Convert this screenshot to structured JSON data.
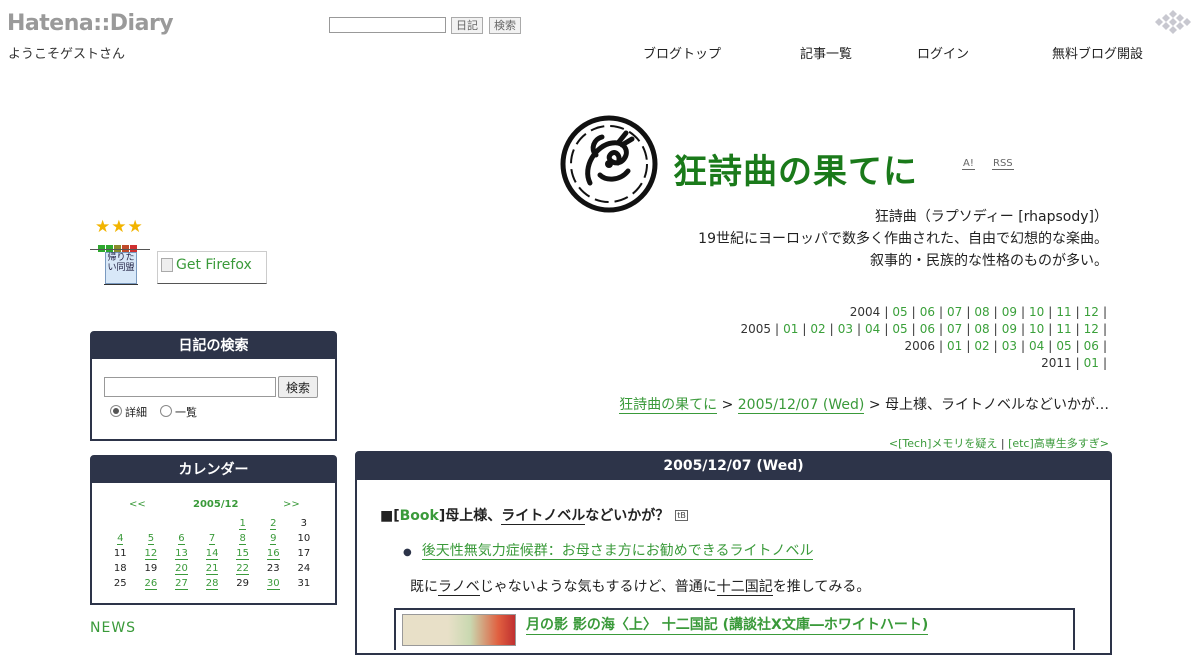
{
  "hatena": {
    "logo": "Hatena::Diary",
    "welcome": "ようこそゲストさん",
    "search_placeholder": "",
    "diary_button": "日記",
    "search_button": "検索",
    "nav": {
      "blog_top": "ブログトップ",
      "article_list": "記事一覧",
      "login": "ログイン",
      "create_blog": "無料ブログ開設"
    }
  },
  "blog": {
    "title": "狂詩曲の果てに",
    "ai_link": "A!",
    "rss_link": "RSS",
    "description": [
      "狂詩曲（ラプソディー [rhapsody]）",
      "19世紀にヨーロッパで数多く作曲された、自由で幻想的な楽曲。",
      "叙事的・民族的な性格のものが多い。"
    ]
  },
  "archive": [
    {
      "year": "2004",
      "months": [
        "05",
        "06",
        "07",
        "08",
        "09",
        "10",
        "11",
        "12"
      ]
    },
    {
      "year": "2005",
      "months": [
        "01",
        "02",
        "03",
        "04",
        "05",
        "06",
        "07",
        "08",
        "09",
        "10",
        "11",
        "12"
      ]
    },
    {
      "year": "2006",
      "months": [
        "01",
        "02",
        "03",
        "04",
        "05",
        "06"
      ]
    },
    {
      "year": "2011",
      "months": [
        "01"
      ]
    }
  ],
  "breadcrumb": {
    "home": "狂詩曲の果てに",
    "date": "2005/12/07 (Wed)",
    "current": "母上様、ライトノベルなどいかが…"
  },
  "prevnext": {
    "prev": "<[Tech]メモリを疑え",
    "next": "[etc]高専生多すぎ>"
  },
  "sidebar": {
    "stars": "★★★",
    "color_stars": [
      "#2ea82e",
      "#2ea82e",
      "#8a8a2a",
      "#c04a2a",
      "#d03030"
    ],
    "badge_text": "帰りたい同盟",
    "firefox_alt": "Get Firefox",
    "search": {
      "title": "日記の検索",
      "button": "検索",
      "radio_detail": "詳細",
      "radio_list": "一覧"
    },
    "calendar": {
      "title": "カレンダー",
      "prev": "<<",
      "month": "2005/12",
      "next": ">>",
      "weeks": [
        [
          {
            "d": "",
            "l": false
          },
          {
            "d": "",
            "l": false
          },
          {
            "d": "",
            "l": false
          },
          {
            "d": "",
            "l": false
          },
          {
            "d": "1",
            "l": true
          },
          {
            "d": "2",
            "l": true
          },
          {
            "d": "3",
            "l": false
          }
        ],
        [
          {
            "d": "4",
            "l": true
          },
          {
            "d": "5",
            "l": true
          },
          {
            "d": "6",
            "l": true
          },
          {
            "d": "7",
            "l": true
          },
          {
            "d": "8",
            "l": true
          },
          {
            "d": "9",
            "l": true
          },
          {
            "d": "10",
            "l": false
          }
        ],
        [
          {
            "d": "11",
            "l": false
          },
          {
            "d": "12",
            "l": true
          },
          {
            "d": "13",
            "l": true
          },
          {
            "d": "14",
            "l": true
          },
          {
            "d": "15",
            "l": true
          },
          {
            "d": "16",
            "l": true
          },
          {
            "d": "17",
            "l": false
          }
        ],
        [
          {
            "d": "18",
            "l": false
          },
          {
            "d": "19",
            "l": false
          },
          {
            "d": "20",
            "l": true
          },
          {
            "d": "21",
            "l": true
          },
          {
            "d": "22",
            "l": true
          },
          {
            "d": "23",
            "l": false
          },
          {
            "d": "24",
            "l": false
          }
        ],
        [
          {
            "d": "25",
            "l": false
          },
          {
            "d": "26",
            "l": true
          },
          {
            "d": "27",
            "l": true
          },
          {
            "d": "28",
            "l": true
          },
          {
            "d": "29",
            "l": false
          },
          {
            "d": "30",
            "l": true
          },
          {
            "d": "31",
            "l": false
          }
        ]
      ]
    },
    "news_label": "NEWS"
  },
  "entry": {
    "date_header": "2005/12/07 (Wed)",
    "title_prefix": "■[",
    "category": "Book",
    "title_mid": "]母上様、",
    "title_keyword": "ライトノベル",
    "title_suffix": "などいかが？",
    "tb_icon": "tB",
    "link_bullet": "●",
    "link_text": "後天性無気力症候群：お母さま方にお勧めできるライトノベル",
    "body_pre": "既に",
    "body_kw1": "ラノベ",
    "body_mid": "じゃないような気もするけど、普通に",
    "body_kw2": "十二国記",
    "body_post": "を推してみる。",
    "amazon_title": "月の影 影の海〈上〉 十二国記 (講談社X文庫―ホワイトハート)"
  }
}
